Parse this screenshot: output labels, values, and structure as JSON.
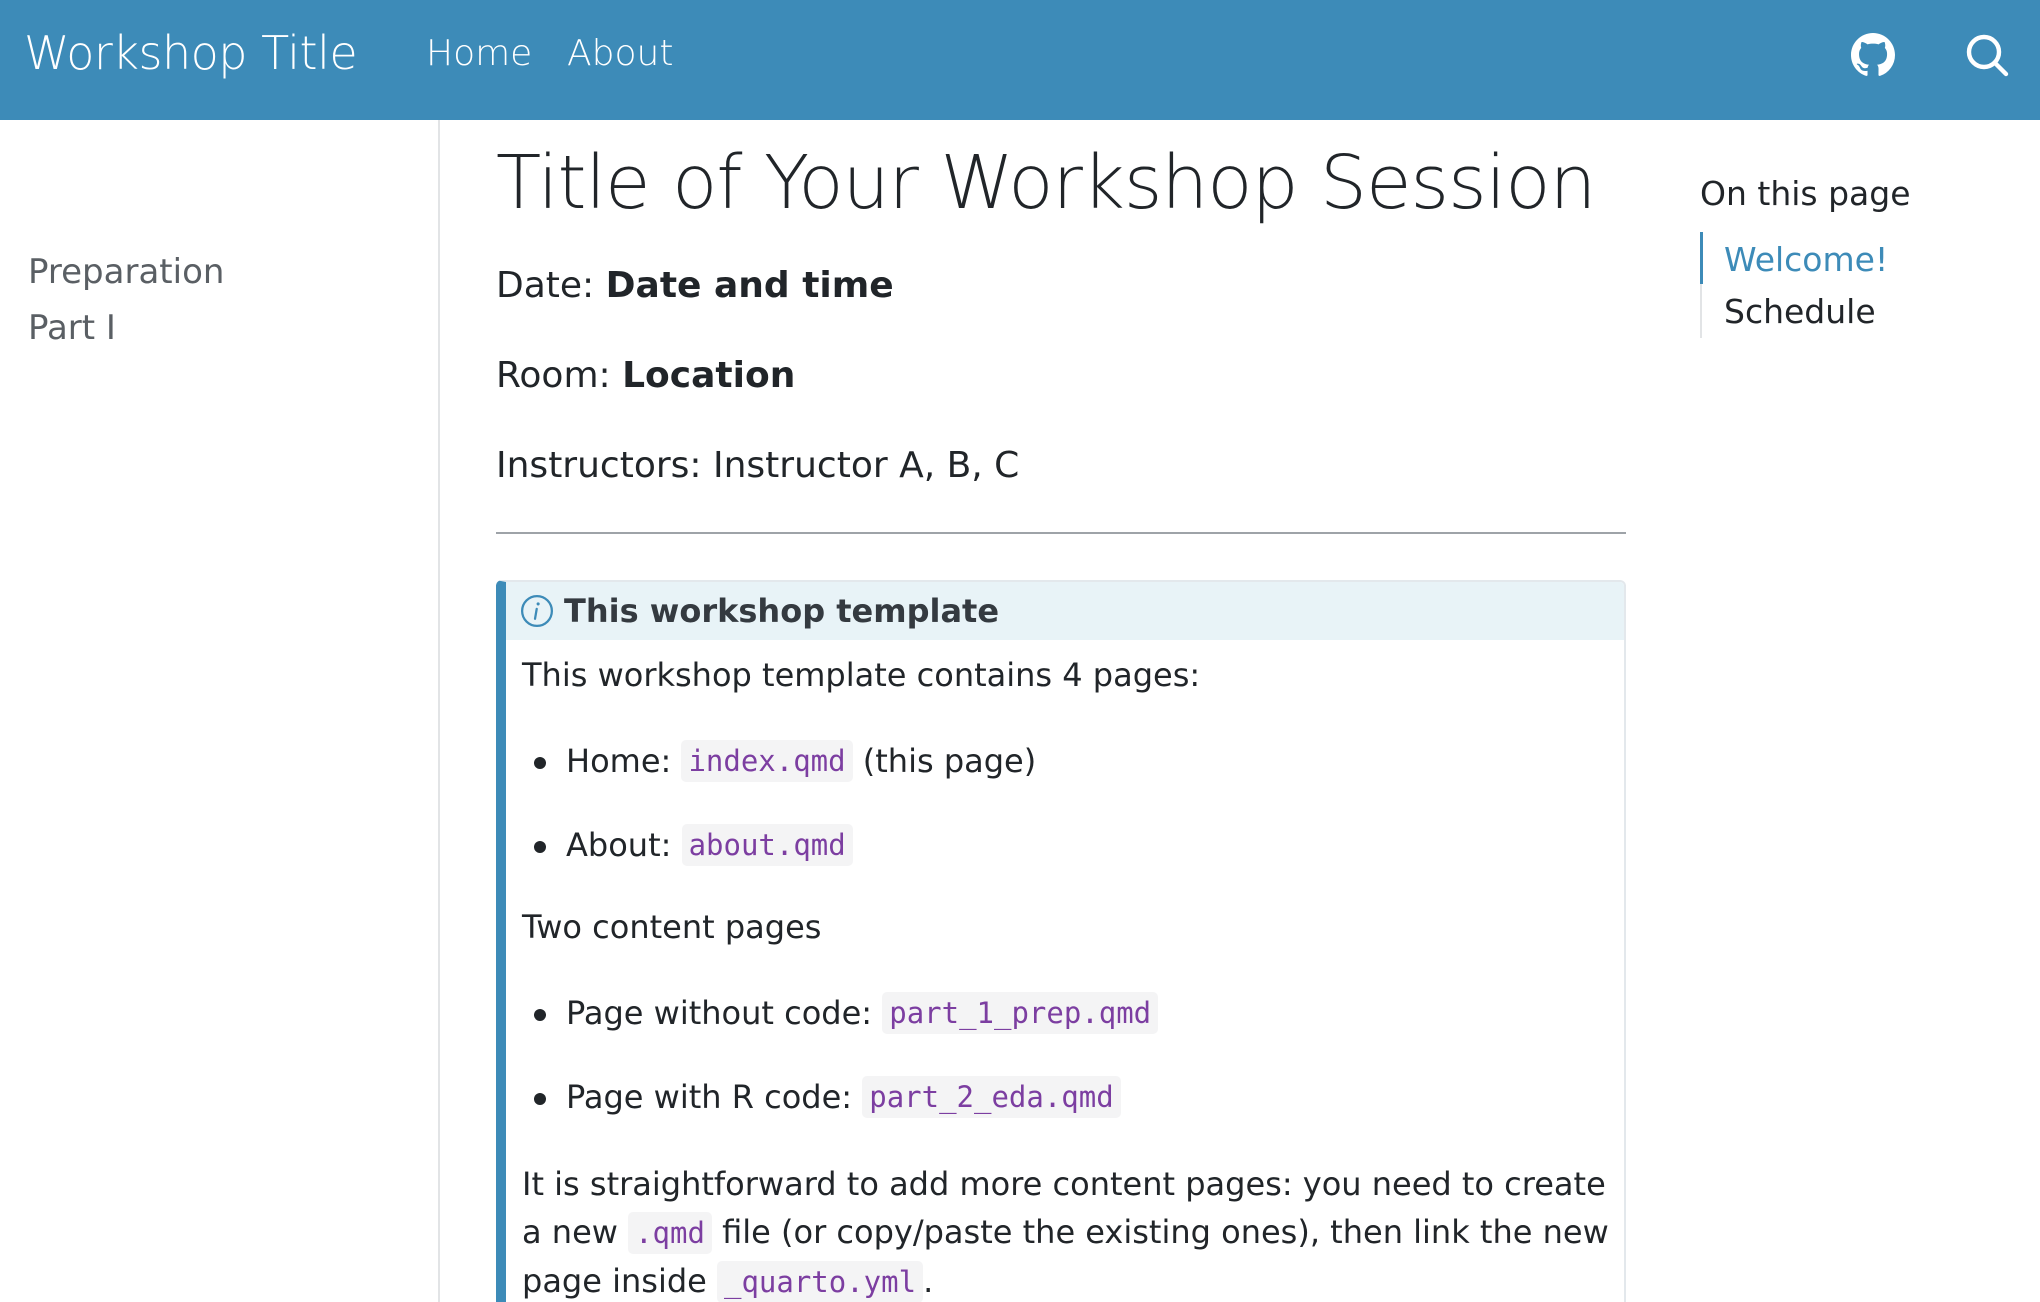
{
  "navbar": {
    "brand": "Workshop Title",
    "links": [
      "Home",
      "About"
    ],
    "icons": [
      "github-icon",
      "search-icon"
    ],
    "color": "#3d8bb8"
  },
  "sidebar": {
    "items": [
      "Preparation",
      "Part I"
    ]
  },
  "main": {
    "title": "Title of Your Workshop Session",
    "date_label": "Date:",
    "date_value": "Date and time",
    "room_label": "Room:",
    "room_value": "Location",
    "instructors": "Instructors: Instructor A, B, C"
  },
  "callout": {
    "icon": "info-icon",
    "title": "This workshop template",
    "intro": "This workshop template contains 4 pages:",
    "list1": [
      {
        "label": "Home:",
        "code": "index.qmd",
        "suffix": "(this page)"
      },
      {
        "label": "About:",
        "code": "about.qmd",
        "suffix": ""
      }
    ],
    "two_content": "Two content pages",
    "list2": [
      {
        "label": "Page without code:",
        "code": "part_1_prep.qmd"
      },
      {
        "label": "Page with R code:",
        "code": "part_2_eda.qmd"
      }
    ],
    "last_part1": "It is straightforward to add more content pages: you need to create a new",
    "last_code1": ".qmd",
    "last_part2": "file (or copy/paste the existing ones), then link the new page inside",
    "last_code2": "_quarto.yml",
    "last_part3": "."
  },
  "toc": {
    "heading": "On this page",
    "items": [
      "Welcome!",
      "Schedule"
    ],
    "active": "Welcome!"
  }
}
